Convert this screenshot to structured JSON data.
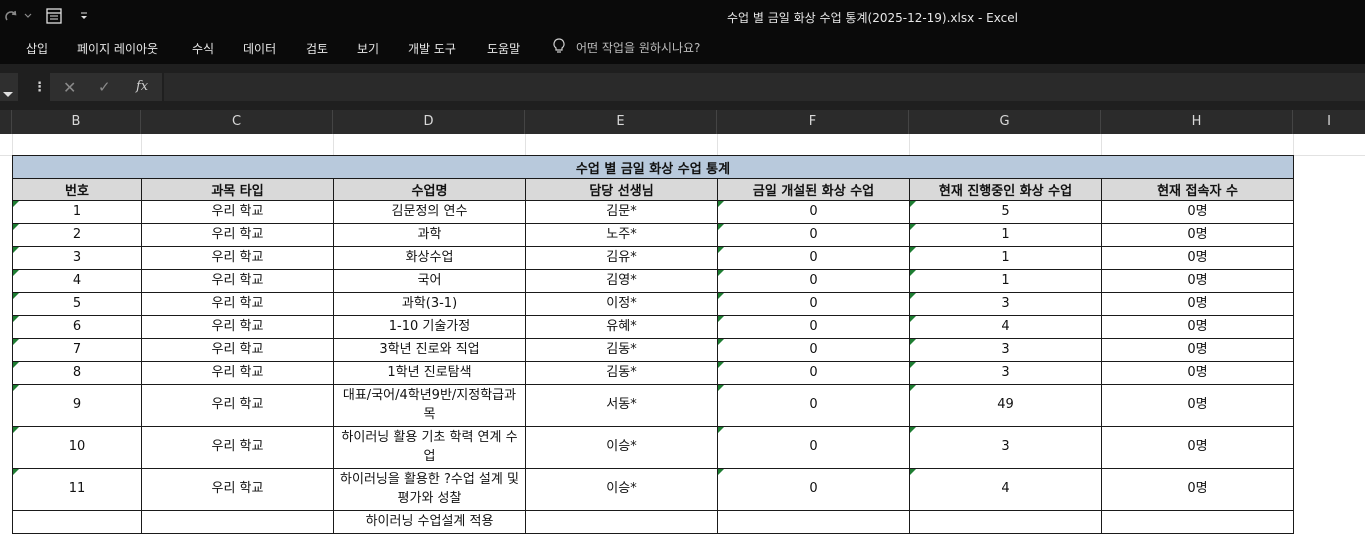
{
  "titlebar": {
    "doc_title": "수업 별 금일 화상 수업 통계(2025-12-19).xlsx  -  Excel"
  },
  "ribbon": {
    "tabs": [
      "삽입",
      "페이지 레이아웃",
      "수식",
      "데이터",
      "검토",
      "보기",
      "개발 도구",
      "도움말"
    ],
    "tell_me": "어떤 작업을 원하시나요?"
  },
  "formula_bar": {
    "fx_label": "fx",
    "value": ""
  },
  "columns": [
    "B",
    "C",
    "D",
    "E",
    "F",
    "G",
    "H",
    "I"
  ],
  "sheet": {
    "title": "수업 별 금일 화상 수업 통계",
    "headers": [
      "번호",
      "과목 타입",
      "수업명",
      "담당 선생님",
      "금일 개설된 화상 수업",
      "현재 진행중인 화상 수업",
      "현재 접속자 수"
    ],
    "rows": [
      [
        "1",
        "우리 학교",
        "김문정의 연수",
        "김문*",
        "0",
        "5",
        "0명"
      ],
      [
        "2",
        "우리 학교",
        "과학",
        "노주*",
        "0",
        "1",
        "0명"
      ],
      [
        "3",
        "우리 학교",
        "화상수업",
        "김유*",
        "0",
        "1",
        "0명"
      ],
      [
        "4",
        "우리 학교",
        "국어",
        "김영*",
        "0",
        "1",
        "0명"
      ],
      [
        "5",
        "우리 학교",
        "과학(3-1)",
        "이정*",
        "0",
        "3",
        "0명"
      ],
      [
        "6",
        "우리 학교",
        "1-10 기술가정",
        "유혜*",
        "0",
        "4",
        "0명"
      ],
      [
        "7",
        "우리 학교",
        "3학년 진로와 직업",
        "김동*",
        "0",
        "3",
        "0명"
      ],
      [
        "8",
        "우리 학교",
        "1학년 진로탐색",
        "김동*",
        "0",
        "3",
        "0명"
      ],
      [
        "9",
        "우리 학교",
        "대표/국어/4학년9반/지정학급과목",
        "서동*",
        "0",
        "49",
        "0명"
      ],
      [
        "10",
        "우리 학교",
        "하이러닝 활용 기초 학력 연계 수업",
        "이승*",
        "0",
        "3",
        "0명"
      ],
      [
        "11",
        "우리 학교",
        "하이러닝을 활용한 ?수업 설계 및 평가와 성찰",
        "이승*",
        "0",
        "4",
        "0명"
      ],
      [
        "",
        "",
        "하이러닝 수업설계 적용",
        "",
        "",
        "",
        ""
      ]
    ]
  }
}
